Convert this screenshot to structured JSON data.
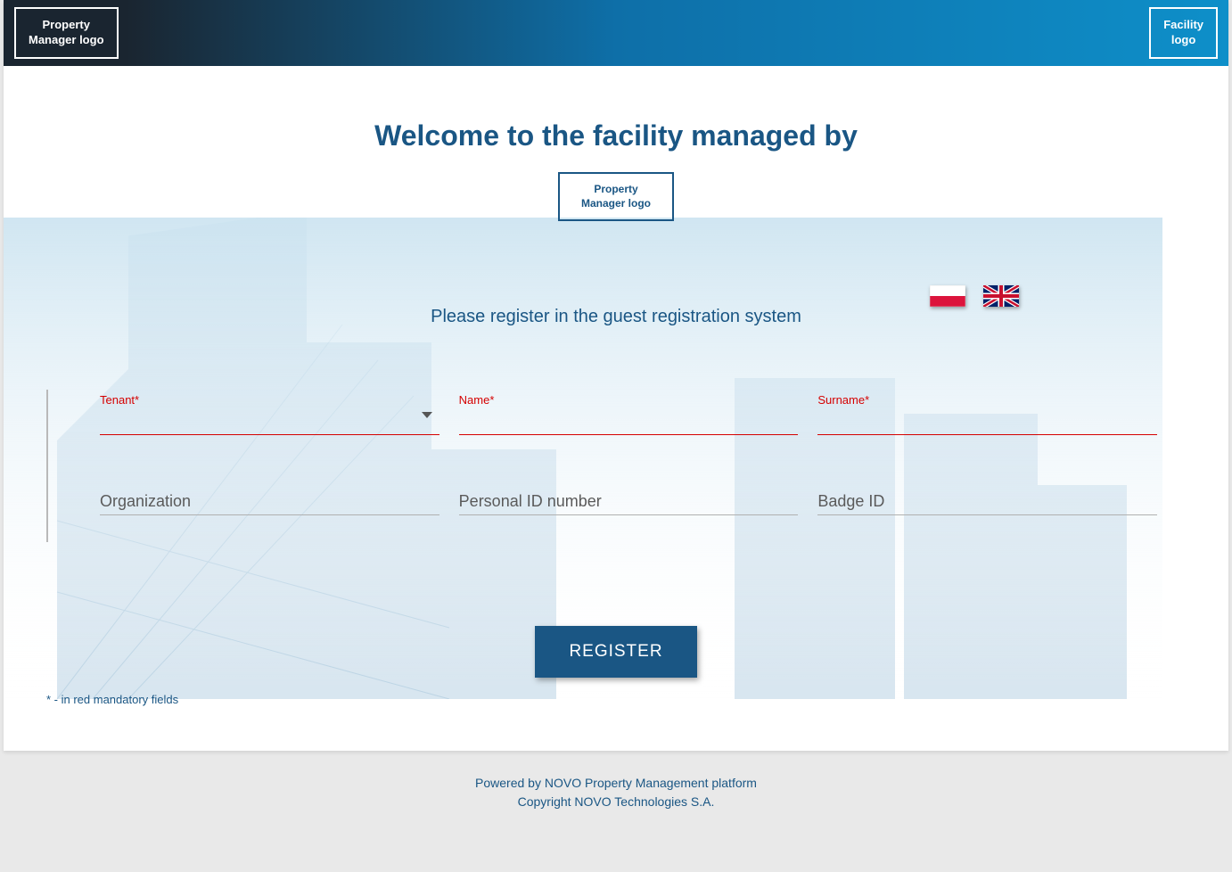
{
  "header": {
    "left_logo_line1": "Property",
    "left_logo_line2": "Manager logo",
    "right_logo_line1": "Facility",
    "right_logo_line2": "logo"
  },
  "main": {
    "welcome_title": "Welcome to the facility managed by",
    "center_logo_line1": "Property",
    "center_logo_line2": "Manager logo",
    "subtitle": "Please register in the guest registration system",
    "register_button": "REGISTER",
    "mandatory_note": "* - in red mandatory fields"
  },
  "languages": {
    "polish": "Polish",
    "english": "English"
  },
  "form": {
    "tenant_label": "Tenant*",
    "name_label": "Name*",
    "surname_label": "Surname*",
    "organization_placeholder": "Organization",
    "personal_id_placeholder": "Personal ID number",
    "badge_id_placeholder": "Badge ID"
  },
  "footer": {
    "line1": "Powered by NOVO Property Management platform",
    "line2": "Copyright NOVO Technologies S.A."
  },
  "colors": {
    "primary": "#1a5684",
    "error": "#d50000"
  }
}
